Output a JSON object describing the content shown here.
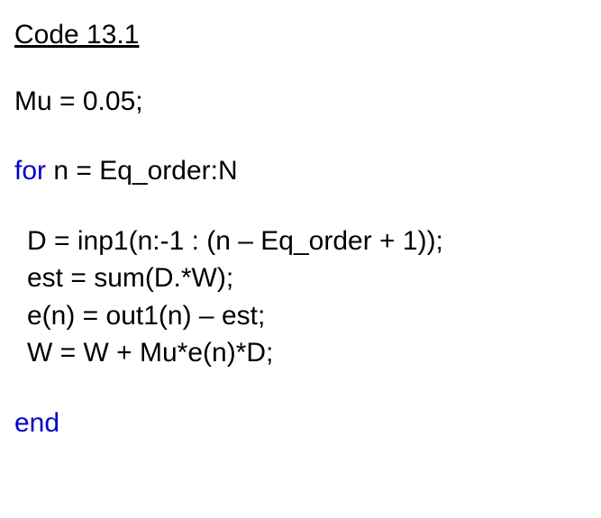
{
  "title": "Code 13.1",
  "lines": {
    "l1": "Mu = 0.05;",
    "kw_for": "for",
    "l2_rest": " n = Eq_order:N",
    "l3": "D = inp1(n:-1 : (n – Eq_order + 1));",
    "l4": "est = sum(D.*W);",
    "l5": "e(n) = out1(n) – est;",
    "l6": "W = W + Mu*e(n)*D;",
    "kw_end": "end"
  }
}
